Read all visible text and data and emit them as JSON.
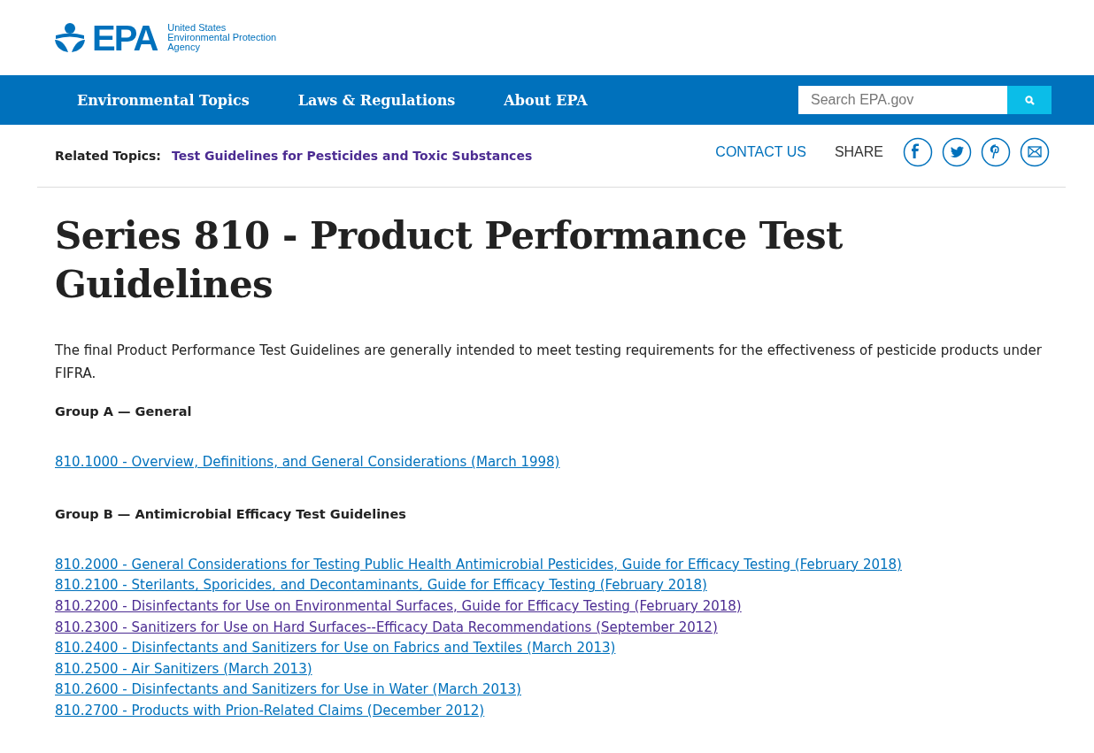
{
  "header": {
    "logo_text": "EPA",
    "agency_lines": [
      "United States",
      "Environmental Protection",
      "Agency"
    ]
  },
  "nav": {
    "items": [
      "Environmental Topics",
      "Laws & Regulations",
      "About EPA"
    ],
    "search": {
      "placeholder": "Search EPA.gov"
    }
  },
  "related": {
    "label": "Related Topics:",
    "link": "Test Guidelines for Pesticides and Toxic Substances",
    "contact": "CONTACT US",
    "share_label": "SHARE",
    "share_icons": [
      {
        "kind": "facebook"
      },
      {
        "kind": "twitter"
      },
      {
        "kind": "pinterest"
      },
      {
        "kind": "email"
      }
    ]
  },
  "title": "Series 810 - Product Performance Test Guidelines",
  "intro": "The final Product Performance Test Guidelines are generally intended to meet testing requirements for the effectiveness of pesticide products under FIFRA.",
  "groups": [
    {
      "heading": "Group A — General",
      "links": [
        {
          "text": "810.1000 - Overview, Definitions, and General Considerations (March 1998)",
          "visited": false
        }
      ]
    },
    {
      "heading": "Group B — Antimicrobial Efficacy Test Guidelines",
      "links": [
        {
          "text": "810.2000 - General Considerations for Testing Public Health Antimicrobial Pesticides, Guide for Efficacy Testing (February 2018)",
          "visited": false
        },
        {
          "text": "810.2100 - Sterilants, Sporicides, and Decontaminants, Guide for Efficacy Testing (February 2018)",
          "visited": false
        },
        {
          "text": "810.2200 - Disinfectants for Use on Environmental Surfaces, Guide for Efficacy Testing (February 2018)",
          "visited": true
        },
        {
          "text": "810.2300 - Sanitizers for Use on Hard Surfaces--Efficacy Data Recommendations (September 2012)",
          "visited": true
        },
        {
          "text": "810.2400 - Disinfectants and Sanitizers for Use on Fabrics and Textiles (March 2013)",
          "visited": false
        },
        {
          "text": "810.2500 - Air Sanitizers (March 2013)",
          "visited": false
        },
        {
          "text": "810.2600 - Disinfectants and Sanitizers for Use in Water (March 2013)",
          "visited": false
        },
        {
          "text": "810.2700 - Products with Prion-Related Claims (December 2012)",
          "visited": false
        }
      ]
    }
  ]
}
